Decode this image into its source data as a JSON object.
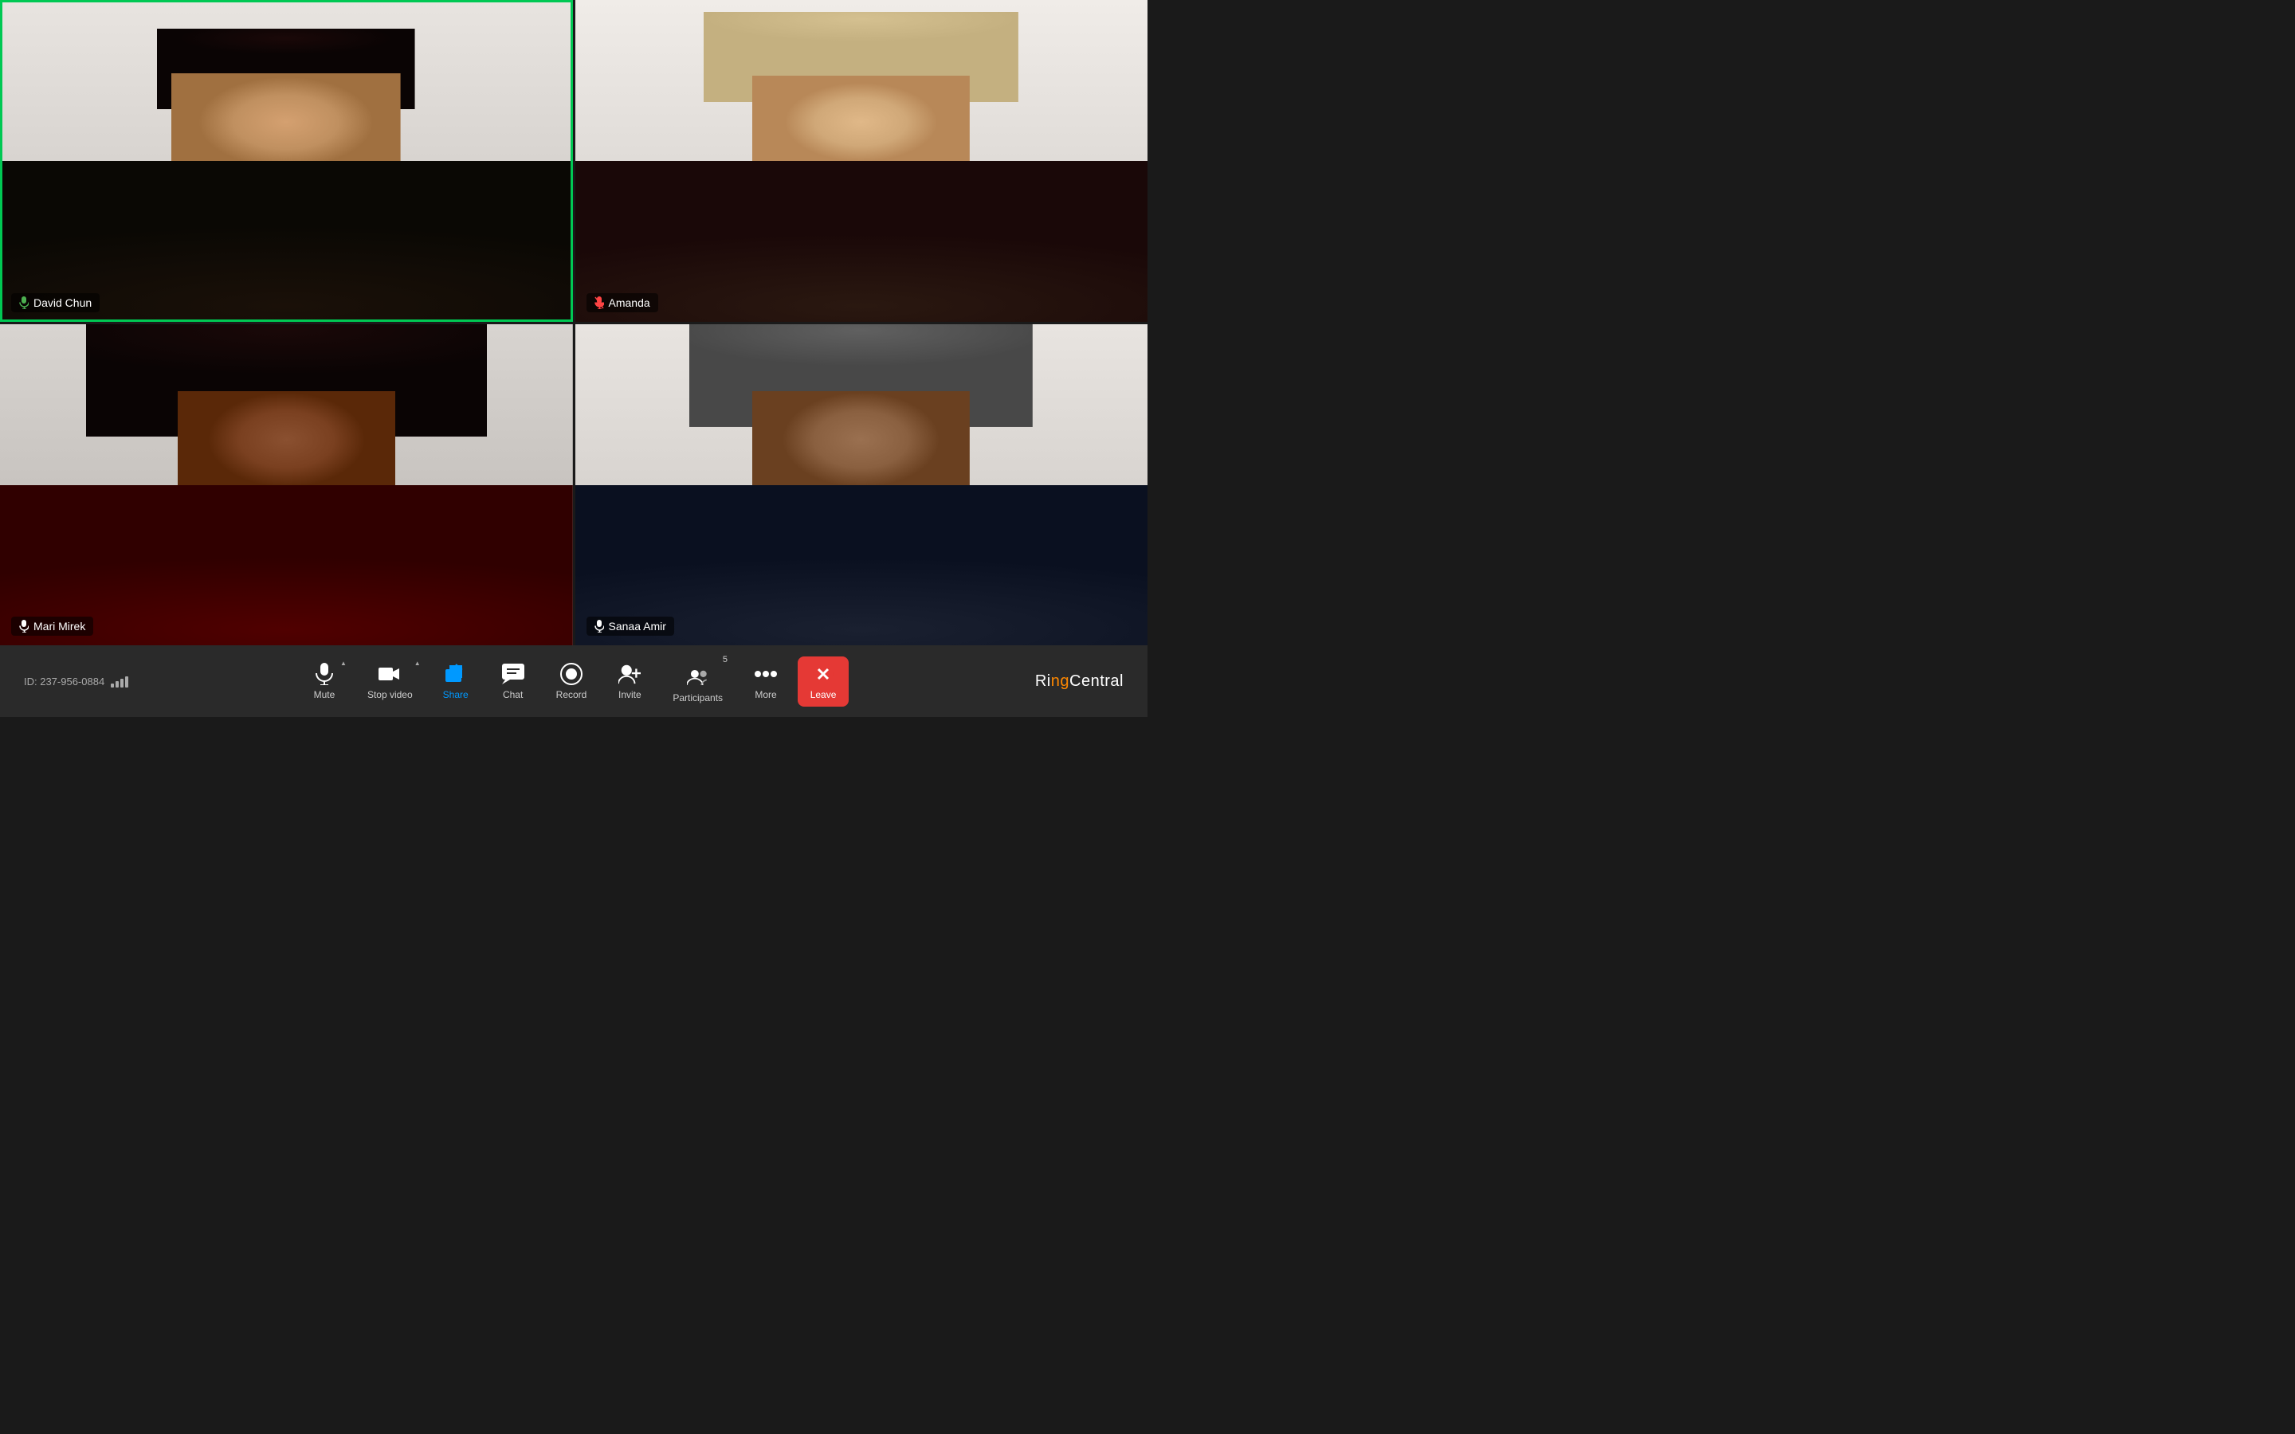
{
  "meeting": {
    "id": "ID: 237-956-0884",
    "participants": [
      {
        "name": "David Chun",
        "muted": false,
        "active_speaker": true,
        "position": "top-left"
      },
      {
        "name": "Amanda",
        "muted": true,
        "active_speaker": false,
        "position": "top-right"
      },
      {
        "name": "Mari Mirek",
        "muted": false,
        "active_speaker": false,
        "position": "bottom-left"
      },
      {
        "name": "Sanaa Amir",
        "muted": false,
        "active_speaker": false,
        "position": "bottom-right"
      }
    ]
  },
  "toolbar": {
    "mute_label": "Mute",
    "stop_video_label": "Stop video",
    "share_label": "Share",
    "chat_label": "Chat",
    "record_label": "Record",
    "invite_label": "Invite",
    "participants_label": "Participants",
    "participants_count": "5",
    "more_label": "More",
    "leave_label": "Leave"
  },
  "branding": {
    "logo": "RingCentral"
  }
}
